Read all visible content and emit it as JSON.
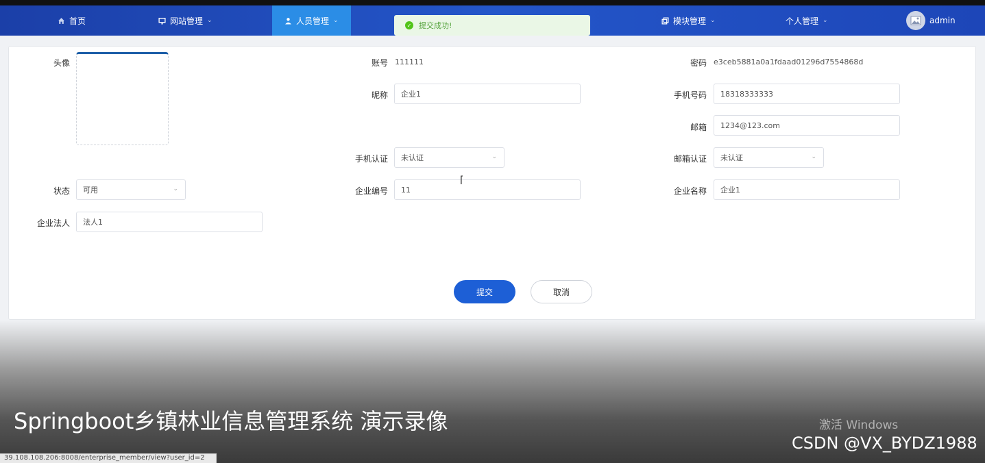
{
  "nav": {
    "home": "首页",
    "site_mgmt": "网站管理",
    "people_mgmt": "人员管理",
    "module_mgmt": "模块管理",
    "personal_mgmt": "个人管理",
    "user": "admin"
  },
  "toast": {
    "message": "提交成功!"
  },
  "form": {
    "avatar_label": "头像",
    "account_label": "账号",
    "account_value": "111111",
    "password_label": "密码",
    "password_value": "e3ceb5881a0a1fdaad01296d7554868d",
    "nickname_label": "昵称",
    "nickname_value": "企业1",
    "phone_label": "手机号码",
    "phone_value": "18318333333",
    "email_label": "邮箱",
    "email_value": "1234@123.com",
    "phone_verify_label": "手机认证",
    "phone_verify_value": "未认证",
    "email_verify_label": "邮箱认证",
    "email_verify_value": "未认证",
    "status_label": "状态",
    "status_value": "可用",
    "company_no_label": "企业编号",
    "company_no_value": "11",
    "company_name_label": "企业名称",
    "company_name_value": "企业1",
    "legal_person_label": "企业法人",
    "legal_person_value": "法人1",
    "submit": "提交",
    "cancel": "取消"
  },
  "video": {
    "caption": "Springboot乡镇林业信息管理系统 演示录像",
    "activate_text": "激活 Windows",
    "watermark": "CSDN @VX_BYDZ1988",
    "status_url": "39.108.108.206:8008/enterprise_member/view?user_id=2"
  },
  "colors": {
    "nav_bg": "#2456c9",
    "nav_active": "#2b8de6",
    "primary": "#1d5fd6",
    "success": "#52c41a"
  }
}
